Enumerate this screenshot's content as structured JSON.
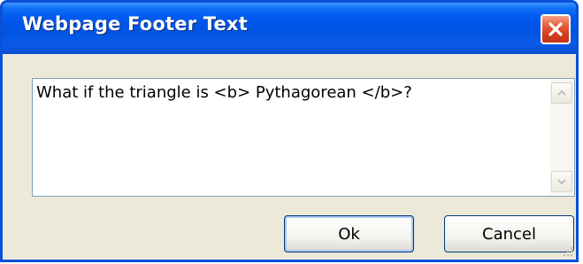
{
  "window": {
    "title": "Webpage Footer Text",
    "close_icon": "close-icon"
  },
  "editor": {
    "value": "What if the triangle is <b> Pythagorean </b>?",
    "scroll_up_icon": "chevron-up-icon",
    "scroll_down_icon": "chevron-down-icon"
  },
  "buttons": {
    "ok_label": "Ok",
    "cancel_label": "Cancel"
  },
  "colors": {
    "titlebar": "#0054e3",
    "close_button": "#d23c1c",
    "dialog_background": "#ece9d8",
    "input_border": "#7f9db9"
  }
}
